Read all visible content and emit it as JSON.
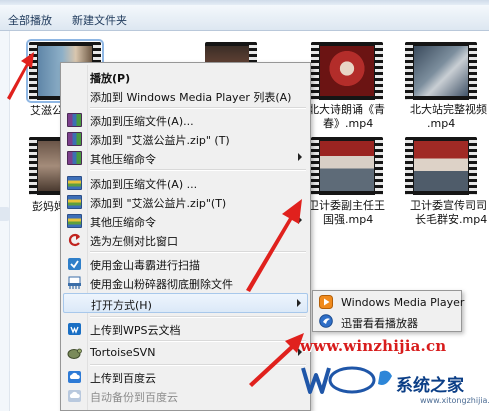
{
  "toolbar": {
    "organize_label": "全部播放",
    "new_folder_label": "新建文件夹"
  },
  "files": [
    {
      "name": "艾滋公",
      "selected": true
    },
    {
      "name": "北大诗朗诵《青春》.mp4"
    },
    {
      "name": "北大站完整视频.mp4"
    },
    {
      "name": "彭妈妈"
    },
    {
      "name": "卫计委副主任王国强.mp4"
    },
    {
      "name": "卫计委宣传司司长毛群安.mp4"
    }
  ],
  "captions": {
    "f0": "艾滋公",
    "f1_line1": "北大诗朗诵《青",
    "f1_line2": "春》.mp4",
    "f2_line1": "北大站完整视频",
    "f2_line2": ".mp4",
    "f3": "彭妈妈",
    "f4_line1": "卫计委副主任王",
    "f4_line2": "国强.mp4",
    "f5_line1": "卫计委宣传司司",
    "f5_line2": "长毛群安.mp4"
  },
  "context_menu": {
    "play": "播放(P)",
    "add_wmp_list": "添加到 Windows Media Player 列表(A)",
    "add_archive_a": "添加到压缩文件(A)...",
    "add_zip_t": "添加到 \"艾滋公益片.zip\" (T)",
    "other_compress_1": "其他压缩命令",
    "add_archive_b": "添加到压缩文件(A) ...",
    "add_zip_t2": "添加到 \"艾滋公益片.zip\"(T)",
    "other_compress_2": "其他压缩命令",
    "compare_left": "选为左侧对比窗口",
    "jinshan_scan": "使用金山毒霸进行扫描",
    "jinshan_shred": "使用金山粉碎器彻底删除文件",
    "open_with": "打开方式(H)",
    "upload_wps": "上传到WPS云文档",
    "tortoise_svn": "TortoiseSVN",
    "upload_baidu": "上传到百度云",
    "auto_backup_baidu": "自动备份到百度云"
  },
  "open_with_menu": {
    "wmp": "Windows Media Player",
    "xunlei": "迅雷看看播放器"
  },
  "watermark": {
    "url": "www.winzhijia.cn",
    "site": "系统之家",
    "sub": "www.xitongzhijia.net"
  },
  "colors": {
    "arrow": "#e0211d",
    "menu_bg": "#f0f0f0",
    "highlight": "#dbe9f8",
    "watermark_red": "#d81c1c",
    "watermark_blue": "#0b3e86"
  }
}
